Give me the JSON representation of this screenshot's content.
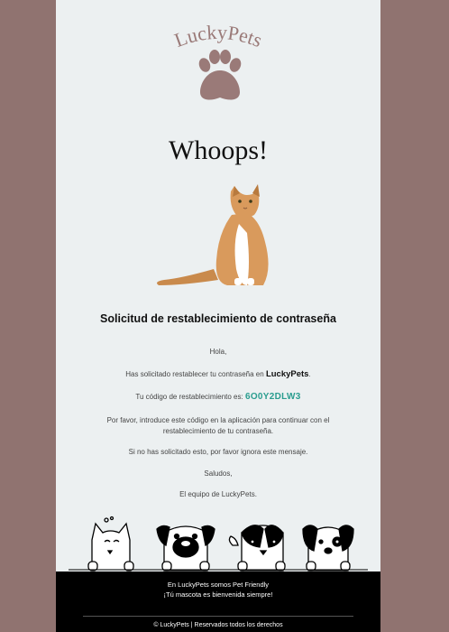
{
  "brand": {
    "name": "LuckyPets",
    "logo_color": "#9a7a78"
  },
  "hero": {
    "headline": "Whoops!"
  },
  "email": {
    "subject": "Solicitud de restablecimiento de contraseña",
    "greeting": "Hola,",
    "requested_prefix": "Has solicitado restablecer tu contraseña en",
    "requested_brand": "LuckyPets",
    "requested_suffix": ".",
    "code_label": "Tu código de restablecimiento es:",
    "code": "6O0Y2DLW3",
    "code_color": "#2a9d8f",
    "instruction_1": "Por favor, introduce este código en la aplicación para continuar con el",
    "instruction_2": "restablecimiento de tu contraseña.",
    "ignore_note": "Si no has solicitado esto, por favor ignora este mensaje.",
    "closing": "Saludos,",
    "signature": "El equipo de LuckyPets."
  },
  "footer": {
    "line1": "En LuckyPets somos Pet Friendly",
    "line2": "¡Tú mascota es bienvenida siempre!",
    "copyright": "© LuckyPets  |  Reservados todos los derechos"
  },
  "colors": {
    "page_bg": "#907370",
    "card_bg": "#ecf0f1",
    "footer_bg": "#000000"
  }
}
